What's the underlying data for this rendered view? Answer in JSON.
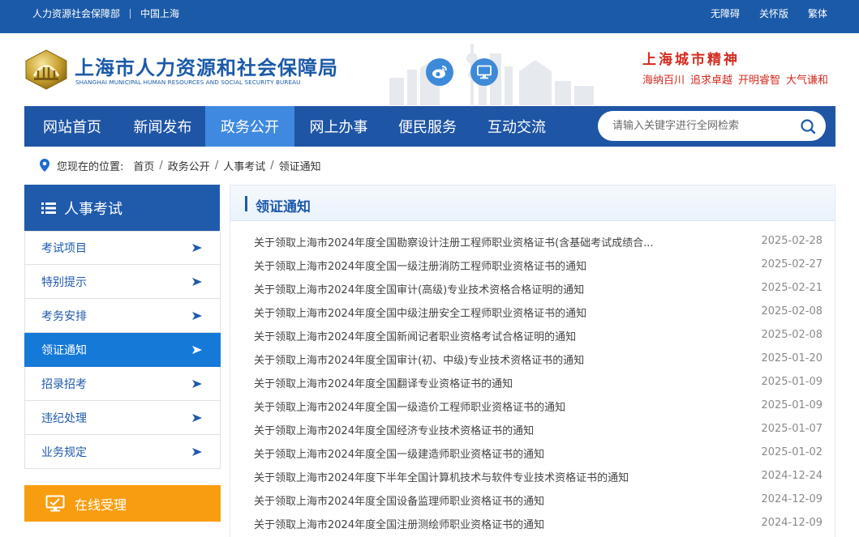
{
  "topbar": {
    "links_left": [
      "人力资源社会保障部",
      "中国上海"
    ],
    "links_right": [
      "无障碍",
      "关怀版",
      "繁体"
    ]
  },
  "header": {
    "title": "上海市人力资源和社会保障局",
    "subtitle": "SHANGHAI MUNICIPAL HUMAN RESOURCES AND SOCIAL SECURITY BUREAU",
    "social_icons": [
      "weibo-icon",
      "monitor-icon"
    ],
    "spirit_title": "上海城市精神",
    "spirit_words": [
      "海纳百川",
      "追求卓越",
      "开明睿智",
      "大气谦和"
    ]
  },
  "nav": {
    "items": [
      "网站首页",
      "新闻发布",
      "政务公开",
      "网上办事",
      "便民服务",
      "互动交流"
    ],
    "active": "政务公开",
    "search_placeholder": "请输入关键字进行全网检索"
  },
  "breadcrumb": {
    "label": "您现在的位置:",
    "items": [
      "首页",
      "政务公开",
      "人事考试",
      "领证通知"
    ]
  },
  "sidebar": {
    "heading": "人事考试",
    "items": [
      "考试项目",
      "特别提示",
      "考务安排",
      "领证通知",
      "招录招考",
      "违纪处理",
      "业务规定"
    ],
    "active": "领证通知",
    "online_label": "在线受理"
  },
  "main": {
    "heading": "领证通知",
    "news": [
      {
        "title": "关于领取上海市2024年度全国勘察设计注册工程师职业资格证书(含基础考试成绩合...",
        "date": "2025-02-28"
      },
      {
        "title": "关于领取上海市2024年度全国一级注册消防工程师职业资格证书的通知",
        "date": "2025-02-27"
      },
      {
        "title": "关于领取上海市2024年度全国审计(高级)专业技术资格合格证明的通知",
        "date": "2025-02-21"
      },
      {
        "title": "关于领取上海市2024年度全国中级注册安全工程师职业资格证书的通知",
        "date": "2025-02-08"
      },
      {
        "title": "关于领取上海市2024年度全国新闻记者职业资格考试合格证明的通知",
        "date": "2025-02-08"
      },
      {
        "title": "关于领取上海市2024年度全国审计(初、中级)专业技术资格证书的通知",
        "date": "2025-01-20"
      },
      {
        "title": "关于领取上海市2024年度全国翻译专业资格证书的通知",
        "date": "2025-01-09"
      },
      {
        "title": "关于领取上海市2024年度全国一级造价工程师职业资格证书的通知",
        "date": "2025-01-09"
      },
      {
        "title": "关于领取上海市2024年度全国经济专业技术资格证书的通知",
        "date": "2025-01-07"
      },
      {
        "title": "关于领取上海市2024年度全国一级建造师职业资格证书的通知",
        "date": "2025-01-02"
      },
      {
        "title": "关于领取上海市2024年度下半年全国计算机技术与软件专业技术资格证书的通知",
        "date": "2024-12-24"
      },
      {
        "title": "关于领取上海市2024年度全国设备监理师职业资格证书的通知",
        "date": "2024-12-09"
      },
      {
        "title": "关于领取上海市2024年度全国注册测绘师职业资格证书的通知",
        "date": "2024-12-09"
      }
    ]
  },
  "colors": {
    "brand_blue": "#1f5aab",
    "active_blue": "#1579d8",
    "spirit_red": "#d42a1e",
    "online_orange": "#f99d10"
  }
}
